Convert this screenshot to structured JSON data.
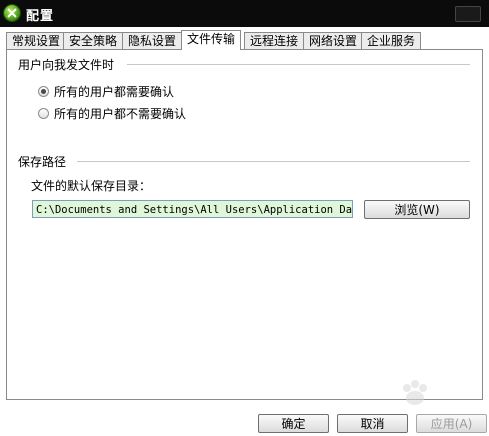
{
  "window": {
    "title": "配置"
  },
  "tabs": [
    {
      "label": "常规设置",
      "active": false
    },
    {
      "label": "安全策略",
      "active": false
    },
    {
      "label": "隐私设置",
      "active": false
    },
    {
      "label": "文件传输",
      "active": true
    },
    {
      "label": "远程连接",
      "active": false
    },
    {
      "label": "网络设置",
      "active": false
    },
    {
      "label": "企业服务",
      "active": false
    }
  ],
  "confirm_group": {
    "title": "用户向我发文件时",
    "options": [
      {
        "label": "所有的用户都需要确认",
        "selected": true
      },
      {
        "label": "所有的用户都不需要确认",
        "selected": false
      }
    ]
  },
  "save_group": {
    "title": "保存路径",
    "dir_label": "文件的默认保存目录：",
    "path_value": "C:\\Documents and Settings\\All Users\\Application Data\\Pe",
    "browse_label": "浏览(W)"
  },
  "footer": {
    "ok_label": "确定",
    "cancel_label": "取消",
    "apply_label": "应用(A)"
  },
  "colors": {
    "titlebar": "#0b0b0b",
    "path_bg": "#dff6d8",
    "accent_icon": "#3d8c12"
  }
}
